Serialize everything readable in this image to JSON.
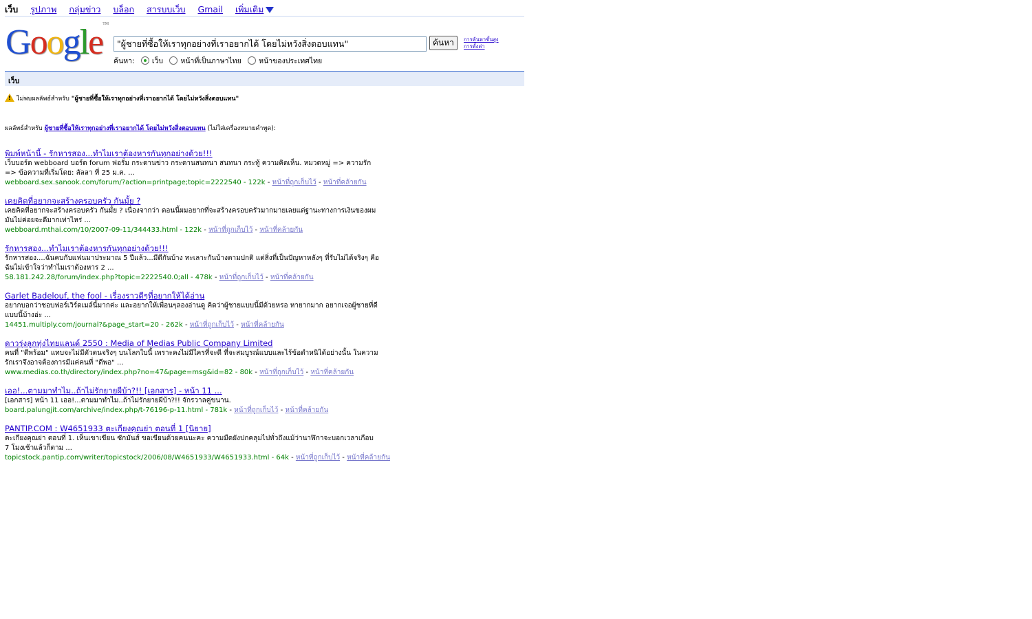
{
  "topnav": {
    "current": "เว็บ",
    "links": [
      "รูปภาพ",
      "กลุ่มข่าว",
      "บล็อก",
      "สารบบเว็บ",
      "Gmail",
      "เพิ่มเติม"
    ]
  },
  "logo": {
    "text": "Google",
    "tm": "TM"
  },
  "search": {
    "query": "\"ผู้ชายที่ซื้อให้เราทุกอย่างที่เราอยากได้ โดยไม่หวังสิ่งตอบแทน\"",
    "button_label": "ค้นหา",
    "advanced_link": "การค้นหาขั้นสูง",
    "preferences_link": "การตั้งค่า"
  },
  "scope": {
    "label": "ค้นหา:",
    "options": [
      "เว็บ",
      "หน้าที่เป็นภาษาไทย",
      "หน้าของประเทศไทย"
    ],
    "selected": 0
  },
  "bar": {
    "label": "เว็บ"
  },
  "warning": {
    "prefix": "ไม่พบผลลัพธ์สำหรับ",
    "query": "\"ผู้ชายที่ซื้อให้เราทุกอย่างที่เราอยากได้ โดยไม่หวังสิ่งตอบแทน\""
  },
  "alt": {
    "prefix": "ผลลัพธ์สำหรับ",
    "link": "ผู้ชายที่ซื้อให้เราทุกอย่างที่เราอยากได้ โดยไม่หวังสิ่งตอบแทน",
    "suffix": "(ไม่ใส่เครื่องหมายคำพูด):"
  },
  "results": [
    {
      "title": "พิมพ์หน้านี้ - รักหารสอง...ทำไมเราต้องหารกันทุกอย่างด้วย!!!",
      "snippet": "เว็บบอร์ด webboard บอร์ด forum ฟอรั่ม กระดานข่าว กระดานสนทนา สนทนา กระทู้ ความคิดเห็น. หมวดหมู่ => ความรัก => ข้อความที่เริ่มโดย: ลัลลา ที่ 25 ม.ค. ...",
      "url": "webboard.sex.sanook.com/forum/?action=printpage;topic=2222540 - 122k",
      "cached": "หน้าที่ถูกเก็บไว้",
      "similar": "หน้าที่คล้ายกัน"
    },
    {
      "title": "เคยคิดที่อยากจะสร้างครอบครัว กันมั้ย ?",
      "snippet": "เคยคิดที่อยากจะสร้างครอบครัว กันมั้ย ? เนื่องจากว่า ตอนนี้ผมอยากที่จะสร้างครอบครัวมากมายเลยแต่ฐานะทางการเงินของผมมันไม่ค่อยจะดีมากเท่าไหร่ ...",
      "url": "webboard.mthai.com/10/2007-09-11/344433.html - 122k",
      "cached": "หน้าที่ถูกเก็บไว้",
      "similar": "หน้าที่คล้ายกัน"
    },
    {
      "title": "รักหารสอง...ทำไมเราต้องหารกันทุกอย่างด้วย!!!",
      "snippet": "รักหารสอง....ฉันคบกับแฟนมาประมาณ 5 ปีแล้ว...มีดีกันบ้าง ทะเลาะกันบ้างตามปกติ แต่สิ่งที่เป็นปัญหาหลังๆ ที่รับไม่ได้จริงๆ คือฉันไม่เข้าใจว่าทำไมเราต้องหาร 2 ...",
      "url": "58.181.242.28/forum/index.php?topic=2222540.0;all - 478k",
      "cached": "หน้าที่ถูกเก็บไว้",
      "similar": "หน้าที่คล้ายกัน"
    },
    {
      "title": "Garlet Badelouf, the fool - เรื่องราวดีๆที่อยากให้ได้อ่าน",
      "snippet": "อยากบอกว่าชอบฟอร์เวิร์ดเมล์นี้มากค่ะ และอยากให้เพื่อนๆลองอ่านดู คิดว่าผู้ชายแบบนี้มีด้วยหรอ หายากมาก อยากเจอผู้ชายที่ดีแบบนี้บ้างอ่ะ ...",
      "url": "14451.multiply.com/journal?&page_start=20 - 262k",
      "cached": "หน้าที่ถูกเก็บไว้",
      "similar": "หน้าที่คล้ายกัน"
    },
    {
      "title": "ดาวรุ่งลูกทุ่งไทยแลนด์ 2550 : Media of Medias Public Company Limited",
      "snippet": "คนที่ \"ดีพร้อม\" แทบจะไม่มีตัวตนจริงๆ บนโลกใบนี้ เพราะคงไม่มีใครที่จะดี ที่จะสมบูรณ์แบบและไร้ข้อตำหนิได้อย่างนั้น ในความรักเราจึงอาจต้องการมีแค่คนที่ \"ดีพอ\" ...",
      "url": "www.medias.co.th/directory/index.php?no=47&page=msg&id=82 - 80k",
      "cached": "หน้าที่ถูกเก็บไว้",
      "similar": "หน้าที่คล้ายกัน"
    },
    {
      "title": "เออ!...ตามมาทำไม..ถ้าไม่รักยายผีบ้า?!! [เอกสาร] - หน้า 11 ...",
      "snippet": "[เอกสาร] หน้า 11 เออ!...ตามมาทำไม..ถ้าไม่รักยายผีบ้า?!! จักรวาลคู่ขนาน.",
      "url": "board.palungjit.com/archive/index.php/t-76196-p-11.html - 781k",
      "cached": "หน้าที่ถูกเก็บไว้",
      "similar": "หน้าที่คล้ายกัน"
    },
    {
      "title": "PANTIP.COM : W4651933 ตะเกียงคุณย่า ตอนที่ 1 [นิยาย]",
      "snippet": "ตะเกียงคุณย่า ตอนที่ 1. เห็นเขาเขียน ซักมันส์ ขอเขียนด้วยคนนะคะ ความมืดยังปกคลุมไปทั่วถึงแม้ว่านาฬิกาจะบอกเวลาเกือบ 7 โมงเช้าแล้วก็ตาม ...",
      "url": "topicstock.pantip.com/writer/topicstock/2006/08/W4651933/W4651933.html - 64k",
      "cached": "หน้าที่ถูกเก็บไว้",
      "similar": "หน้าที่คล้ายกัน"
    }
  ],
  "colors": {
    "link": "#2200cc",
    "url_green": "#008000",
    "bar_bg": "#e5ecf9",
    "bar_border": "#3366cc",
    "warning_yellow": "#e8b000"
  }
}
